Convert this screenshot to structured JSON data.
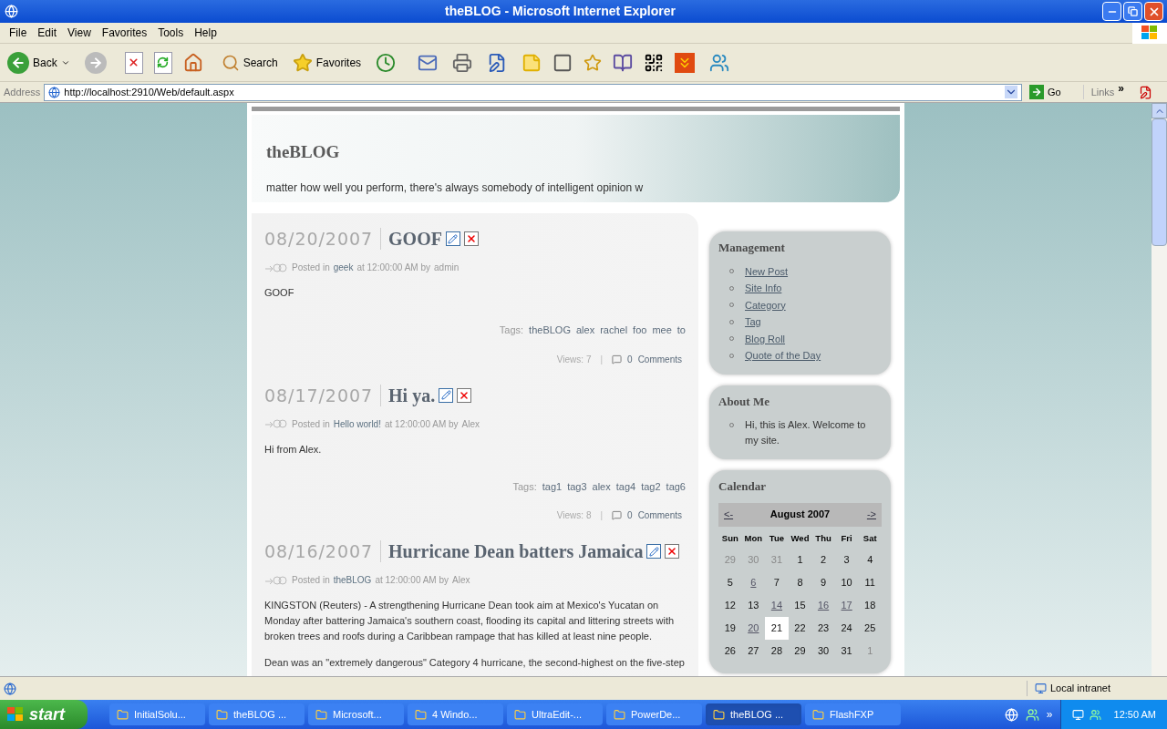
{
  "window": {
    "title": "theBLOG - Microsoft Internet Explorer"
  },
  "menu": [
    "File",
    "Edit",
    "View",
    "Favorites",
    "Tools",
    "Help"
  ],
  "toolbar": {
    "back": "Back",
    "search": "Search",
    "favorites": "Favorites"
  },
  "address": {
    "label": "Address",
    "url": "http://localhost:2910/Web/default.aspx",
    "go": "Go",
    "links": "Links",
    "more": "»"
  },
  "blog": {
    "title": "theBLOG",
    "tagline": "matter how well you perform, there's always somebody of intelligent opinion w"
  },
  "posts": [
    {
      "date": "08/20/2007",
      "title": "GOOF",
      "posted_in": "Posted in",
      "category": "geek",
      "at": "at 12:00:00 AM by",
      "author": "admin",
      "body": [
        "GOOF"
      ],
      "tags_label": "Tags:",
      "tags": [
        "theBLOG",
        "alex",
        "rachel",
        "foo",
        "mee",
        "to"
      ],
      "views": "Views: 7",
      "separator": "|",
      "comments_count": "0",
      "comments": "Comments"
    },
    {
      "date": "08/17/2007",
      "title": "Hi ya.",
      "posted_in": "Posted in",
      "category": "Hello world!",
      "at": "at 12:00:00 AM by",
      "author": "Alex",
      "body": [
        "Hi from Alex."
      ],
      "tags_label": "Tags:",
      "tags": [
        "tag1",
        "tag3",
        "alex",
        "tag4",
        "tag2",
        "tag6"
      ],
      "views": "Views: 8",
      "separator": "|",
      "comments_count": "0",
      "comments": "Comments"
    },
    {
      "date": "08/16/2007",
      "title": "Hurricane Dean batters Jamaica",
      "posted_in": "Posted in",
      "category": "theBLOG",
      "at": "at 12:00:00 AM by",
      "author": "Alex",
      "body": [
        "KINGSTON (Reuters) - A strengthening Hurricane Dean took aim at Mexico's Yucatan on Monday after battering Jamaica's southern coast, flooding its capital and littering streets with broken trees and roofs during a Caribbean rampage that has killed at least nine people.",
        "Dean was an \"extremely dangerous\" Category 4 hurricane, the second-highest on the five-step"
      ]
    }
  ],
  "sidebar": {
    "management": {
      "title": "Management",
      "items": [
        "New Post",
        "Site Info",
        "Category",
        "Tag",
        "Blog Roll",
        "Quote of the Day"
      ]
    },
    "about": {
      "title": "About Me",
      "items": [
        "Hi, this is Alex. Welcome to my site."
      ]
    },
    "calendar": {
      "title": "Calendar",
      "prev": "<-",
      "month": "August 2007",
      "next": "->",
      "weekdays": [
        "Sun",
        "Mon",
        "Tue",
        "Wed",
        "Thu",
        "Fri",
        "Sat"
      ],
      "days": [
        {
          "label": "29",
          "kind": "other",
          "selected": false
        },
        {
          "label": "30",
          "kind": "other",
          "selected": false
        },
        {
          "label": "31",
          "kind": "other",
          "selected": false
        },
        {
          "label": "1",
          "kind": "plain",
          "selected": false
        },
        {
          "label": "2",
          "kind": "plain",
          "selected": false
        },
        {
          "label": "3",
          "kind": "plain",
          "selected": false
        },
        {
          "label": "4",
          "kind": "plain",
          "selected": false
        },
        {
          "label": "5",
          "kind": "plain",
          "selected": false
        },
        {
          "label": "6",
          "kind": "link",
          "selected": false
        },
        {
          "label": "7",
          "kind": "plain",
          "selected": false
        },
        {
          "label": "8",
          "kind": "plain",
          "selected": false
        },
        {
          "label": "9",
          "kind": "plain",
          "selected": false
        },
        {
          "label": "10",
          "kind": "plain",
          "selected": false
        },
        {
          "label": "11",
          "kind": "plain",
          "selected": false
        },
        {
          "label": "12",
          "kind": "plain",
          "selected": false
        },
        {
          "label": "13",
          "kind": "plain",
          "selected": false
        },
        {
          "label": "14",
          "kind": "link",
          "selected": false
        },
        {
          "label": "15",
          "kind": "plain",
          "selected": false
        },
        {
          "label": "16",
          "kind": "link",
          "selected": false
        },
        {
          "label": "17",
          "kind": "link",
          "selected": false
        },
        {
          "label": "18",
          "kind": "plain",
          "selected": false
        },
        {
          "label": "19",
          "kind": "plain",
          "selected": false
        },
        {
          "label": "20",
          "kind": "link",
          "selected": false
        },
        {
          "label": "21",
          "kind": "plain",
          "selected": true
        },
        {
          "label": "22",
          "kind": "plain",
          "selected": false
        },
        {
          "label": "23",
          "kind": "plain",
          "selected": false
        },
        {
          "label": "24",
          "kind": "plain",
          "selected": false
        },
        {
          "label": "25",
          "kind": "plain",
          "selected": false
        },
        {
          "label": "26",
          "kind": "plain",
          "selected": false
        },
        {
          "label": "27",
          "kind": "plain",
          "selected": false
        },
        {
          "label": "28",
          "kind": "plain",
          "selected": false
        },
        {
          "label": "29",
          "kind": "plain",
          "selected": false
        },
        {
          "label": "30",
          "kind": "plain",
          "selected": false
        },
        {
          "label": "31",
          "kind": "plain",
          "selected": false
        },
        {
          "label": "1",
          "kind": "other",
          "selected": false
        }
      ]
    }
  },
  "status_bar": {
    "zone": "Local intranet"
  },
  "taskbar": {
    "start": "start",
    "buttons": [
      {
        "label": "InitialSolu...",
        "selected": false
      },
      {
        "label": "theBLOG ...",
        "selected": false
      },
      {
        "label": "Microsoft...",
        "selected": false
      },
      {
        "label": "4 Windo...",
        "selected": false
      },
      {
        "label": "UltraEdit-...",
        "selected": false
      },
      {
        "label": "PowerDe...",
        "selected": false
      },
      {
        "label": "theBLOG ...",
        "selected": true
      },
      {
        "label": "FlashFXP",
        "selected": false
      }
    ],
    "more": "»",
    "clock": "12:50 AM"
  }
}
